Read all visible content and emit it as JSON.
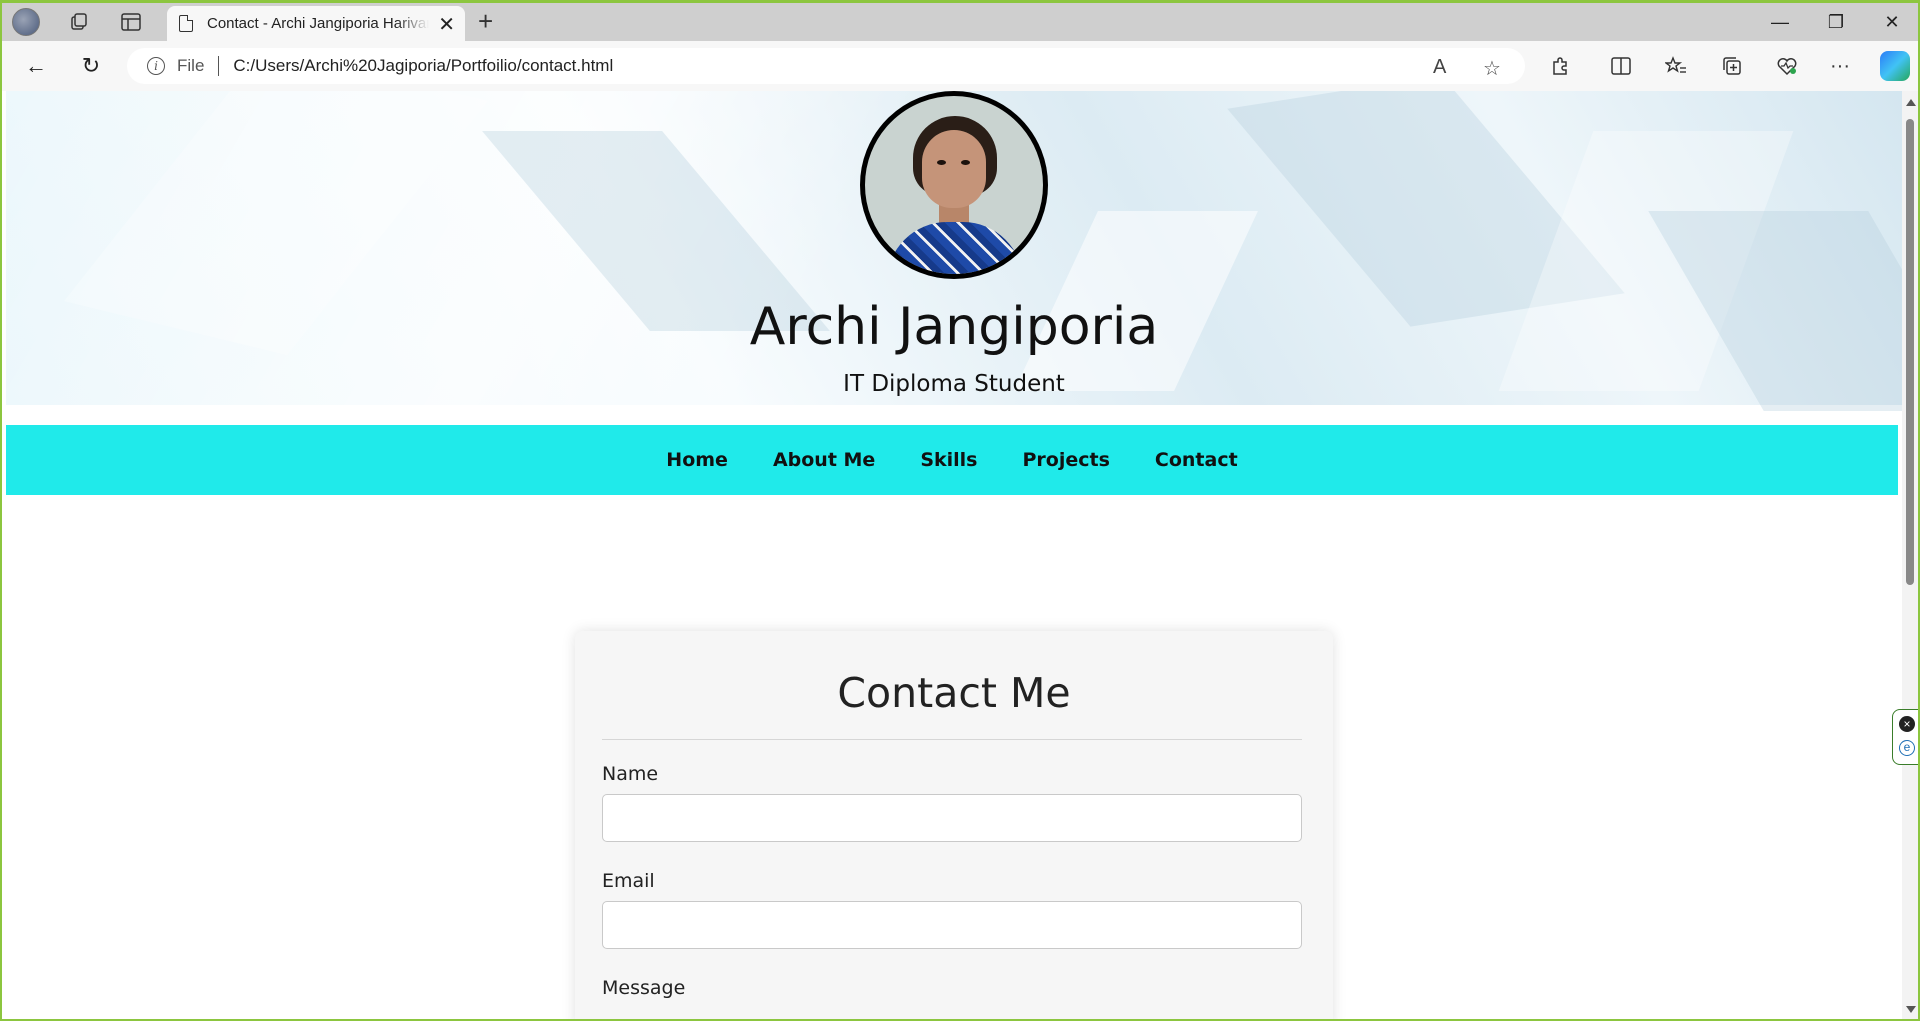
{
  "browser": {
    "tab_title": "Contact - Archi Jangiporia Harivansh",
    "address_scheme": "File",
    "address_url": "C:/Users/Archi%20Jagiporia/Portfoilio/contact.html",
    "close_glyph": "✕",
    "new_tab_glyph": "+",
    "win_minimize": "—",
    "win_restore": "❐",
    "win_close": "✕",
    "back_glyph": "←",
    "reload_glyph": "↻",
    "read_aloud_glyph": "A",
    "favorite_glyph": "☆",
    "more_glyph": "···"
  },
  "header": {
    "name": "Archi Jangiporia",
    "subtitle": "IT Diploma Student"
  },
  "nav": {
    "items": [
      "Home",
      "About Me",
      "Skills",
      "Projects",
      "Contact"
    ]
  },
  "contact_form": {
    "title": "Contact Me",
    "name_label": "Name",
    "name_value": "",
    "email_label": "Email",
    "email_value": "",
    "message_label": "Message"
  },
  "colors": {
    "nav_background": "#20eaea",
    "window_border": "#8cc63f"
  }
}
